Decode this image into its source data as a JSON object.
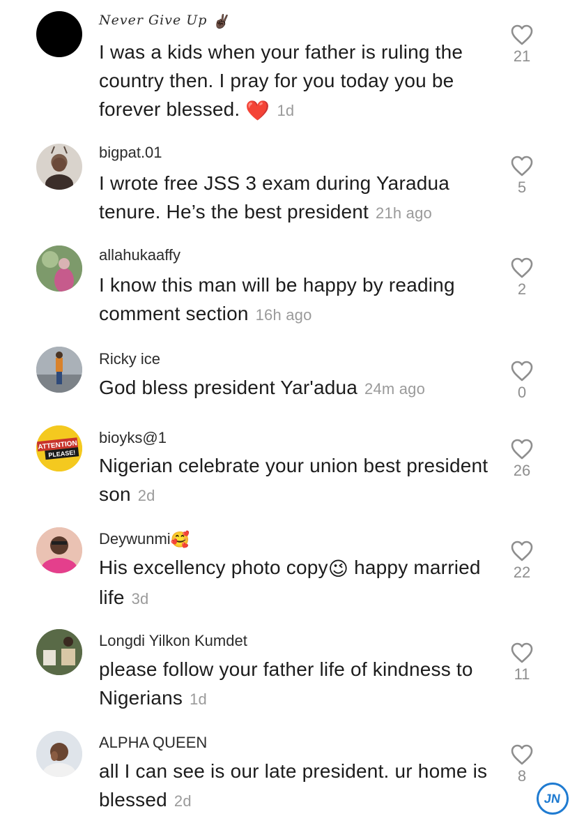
{
  "comments": [
    {
      "username": "Never Give Up",
      "username_emoji": "✌🏿",
      "text": "I was a kids when your father is ruling the country then. I pray for you today you be forever blessed.",
      "text_emoji": "❤️",
      "time": "1d",
      "likes": "21",
      "avatar": "black-circle"
    },
    {
      "username": "bigpat.01",
      "text": "I wrote free JSS 3 exam during Yaradua tenure. He’s the best president",
      "time": "21h ago",
      "likes": "5",
      "avatar": "photo"
    },
    {
      "username": "allahukaaffy",
      "text": "I know this man will be happy by reading comment section",
      "time": "16h ago",
      "likes": "2",
      "avatar": "photo"
    },
    {
      "username": "Ricky ice",
      "text": "God bless president Yar'adua",
      "time": "24m ago",
      "likes": "0",
      "avatar": "photo"
    },
    {
      "username": "bioyks@1",
      "text": "Nigerian celebrate your union best president son",
      "time": "2d",
      "likes": "26",
      "avatar": "attention-please"
    },
    {
      "username": "Deywunmi",
      "username_emoji": "🥰",
      "text_before_emoji": "His excellency photo copy",
      "text_emoji": "😉",
      "text_after_emoji": " happy married life",
      "time": "3d",
      "likes": "22",
      "avatar": "photo"
    },
    {
      "username": "Longdi Yilkon Kumdet",
      "text": "please follow your father life of kindness to Nigerians",
      "time": "1d",
      "likes": "11",
      "avatar": "photo"
    },
    {
      "username": "ALPHA QUEEN",
      "text": "all I can see is our late president. ur home is blessed",
      "time": "2d",
      "likes": "8",
      "avatar": "photo"
    }
  ],
  "attention_badge": {
    "line1": "ATTENTION",
    "line2": "PLEASE!"
  },
  "watermark": {
    "text": "JN"
  },
  "icons": {
    "like": "heart-outline-icon"
  }
}
